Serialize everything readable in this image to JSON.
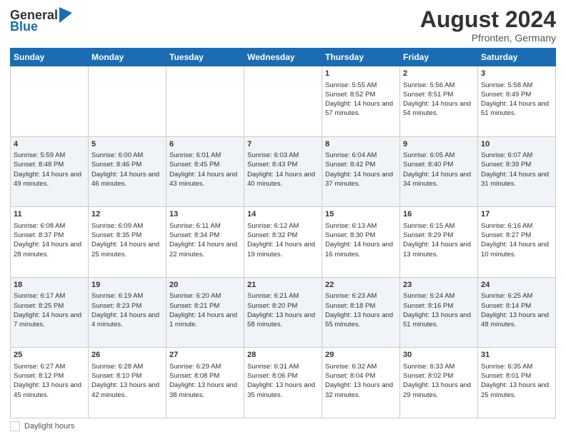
{
  "header": {
    "logo_general": "General",
    "logo_blue": "Blue",
    "month_year": "August 2024",
    "location": "Pfronten, Germany"
  },
  "weekdays": [
    "Sunday",
    "Monday",
    "Tuesday",
    "Wednesday",
    "Thursday",
    "Friday",
    "Saturday"
  ],
  "footer": {
    "label": "Daylight hours"
  },
  "weeks": [
    [
      {
        "day": "",
        "sunrise": "",
        "sunset": "",
        "daylight": ""
      },
      {
        "day": "",
        "sunrise": "",
        "sunset": "",
        "daylight": ""
      },
      {
        "day": "",
        "sunrise": "",
        "sunset": "",
        "daylight": ""
      },
      {
        "day": "",
        "sunrise": "",
        "sunset": "",
        "daylight": ""
      },
      {
        "day": "1",
        "sunrise": "Sunrise: 5:55 AM",
        "sunset": "Sunset: 8:52 PM",
        "daylight": "Daylight: 14 hours and 57 minutes."
      },
      {
        "day": "2",
        "sunrise": "Sunrise: 5:56 AM",
        "sunset": "Sunset: 8:51 PM",
        "daylight": "Daylight: 14 hours and 54 minutes."
      },
      {
        "day": "3",
        "sunrise": "Sunrise: 5:58 AM",
        "sunset": "Sunset: 8:49 PM",
        "daylight": "Daylight: 14 hours and 51 minutes."
      }
    ],
    [
      {
        "day": "4",
        "sunrise": "Sunrise: 5:59 AM",
        "sunset": "Sunset: 8:48 PM",
        "daylight": "Daylight: 14 hours and 49 minutes."
      },
      {
        "day": "5",
        "sunrise": "Sunrise: 6:00 AM",
        "sunset": "Sunset: 8:46 PM",
        "daylight": "Daylight: 14 hours and 46 minutes."
      },
      {
        "day": "6",
        "sunrise": "Sunrise: 6:01 AM",
        "sunset": "Sunset: 8:45 PM",
        "daylight": "Daylight: 14 hours and 43 minutes."
      },
      {
        "day": "7",
        "sunrise": "Sunrise: 6:03 AM",
        "sunset": "Sunset: 8:43 PM",
        "daylight": "Daylight: 14 hours and 40 minutes."
      },
      {
        "day": "8",
        "sunrise": "Sunrise: 6:04 AM",
        "sunset": "Sunset: 8:42 PM",
        "daylight": "Daylight: 14 hours and 37 minutes."
      },
      {
        "day": "9",
        "sunrise": "Sunrise: 6:05 AM",
        "sunset": "Sunset: 8:40 PM",
        "daylight": "Daylight: 14 hours and 34 minutes."
      },
      {
        "day": "10",
        "sunrise": "Sunrise: 6:07 AM",
        "sunset": "Sunset: 8:39 PM",
        "daylight": "Daylight: 14 hours and 31 minutes."
      }
    ],
    [
      {
        "day": "11",
        "sunrise": "Sunrise: 6:08 AM",
        "sunset": "Sunset: 8:37 PM",
        "daylight": "Daylight: 14 hours and 28 minutes."
      },
      {
        "day": "12",
        "sunrise": "Sunrise: 6:09 AM",
        "sunset": "Sunset: 8:35 PM",
        "daylight": "Daylight: 14 hours and 25 minutes."
      },
      {
        "day": "13",
        "sunrise": "Sunrise: 6:11 AM",
        "sunset": "Sunset: 8:34 PM",
        "daylight": "Daylight: 14 hours and 22 minutes."
      },
      {
        "day": "14",
        "sunrise": "Sunrise: 6:12 AM",
        "sunset": "Sunset: 8:32 PM",
        "daylight": "Daylight: 14 hours and 19 minutes."
      },
      {
        "day": "15",
        "sunrise": "Sunrise: 6:13 AM",
        "sunset": "Sunset: 8:30 PM",
        "daylight": "Daylight: 14 hours and 16 minutes."
      },
      {
        "day": "16",
        "sunrise": "Sunrise: 6:15 AM",
        "sunset": "Sunset: 8:29 PM",
        "daylight": "Daylight: 14 hours and 13 minutes."
      },
      {
        "day": "17",
        "sunrise": "Sunrise: 6:16 AM",
        "sunset": "Sunset: 8:27 PM",
        "daylight": "Daylight: 14 hours and 10 minutes."
      }
    ],
    [
      {
        "day": "18",
        "sunrise": "Sunrise: 6:17 AM",
        "sunset": "Sunset: 8:25 PM",
        "daylight": "Daylight: 14 hours and 7 minutes."
      },
      {
        "day": "19",
        "sunrise": "Sunrise: 6:19 AM",
        "sunset": "Sunset: 8:23 PM",
        "daylight": "Daylight: 14 hours and 4 minutes."
      },
      {
        "day": "20",
        "sunrise": "Sunrise: 6:20 AM",
        "sunset": "Sunset: 8:21 PM",
        "daylight": "Daylight: 14 hours and 1 minute."
      },
      {
        "day": "21",
        "sunrise": "Sunrise: 6:21 AM",
        "sunset": "Sunset: 8:20 PM",
        "daylight": "Daylight: 13 hours and 58 minutes."
      },
      {
        "day": "22",
        "sunrise": "Sunrise: 6:23 AM",
        "sunset": "Sunset: 8:18 PM",
        "daylight": "Daylight: 13 hours and 55 minutes."
      },
      {
        "day": "23",
        "sunrise": "Sunrise: 6:24 AM",
        "sunset": "Sunset: 8:16 PM",
        "daylight": "Daylight: 13 hours and 51 minutes."
      },
      {
        "day": "24",
        "sunrise": "Sunrise: 6:25 AM",
        "sunset": "Sunset: 8:14 PM",
        "daylight": "Daylight: 13 hours and 48 minutes."
      }
    ],
    [
      {
        "day": "25",
        "sunrise": "Sunrise: 6:27 AM",
        "sunset": "Sunset: 8:12 PM",
        "daylight": "Daylight: 13 hours and 45 minutes."
      },
      {
        "day": "26",
        "sunrise": "Sunrise: 6:28 AM",
        "sunset": "Sunset: 8:10 PM",
        "daylight": "Daylight: 13 hours and 42 minutes."
      },
      {
        "day": "27",
        "sunrise": "Sunrise: 6:29 AM",
        "sunset": "Sunset: 8:08 PM",
        "daylight": "Daylight: 13 hours and 38 minutes."
      },
      {
        "day": "28",
        "sunrise": "Sunrise: 6:31 AM",
        "sunset": "Sunset: 8:06 PM",
        "daylight": "Daylight: 13 hours and 35 minutes."
      },
      {
        "day": "29",
        "sunrise": "Sunrise: 6:32 AM",
        "sunset": "Sunset: 8:04 PM",
        "daylight": "Daylight: 13 hours and 32 minutes."
      },
      {
        "day": "30",
        "sunrise": "Sunrise: 6:33 AM",
        "sunset": "Sunset: 8:02 PM",
        "daylight": "Daylight: 13 hours and 29 minutes."
      },
      {
        "day": "31",
        "sunrise": "Sunrise: 6:35 AM",
        "sunset": "Sunset: 8:01 PM",
        "daylight": "Daylight: 13 hours and 25 minutes."
      }
    ]
  ]
}
